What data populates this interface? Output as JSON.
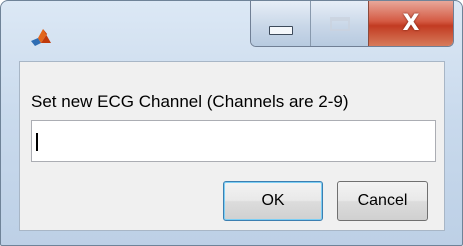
{
  "window": {
    "app_icon": "matlab-icon",
    "controls": {
      "minimize_icon": "minimize-icon",
      "maximize_icon": "maximize-icon",
      "close_icon": "close-icon",
      "close_glyph": "X"
    }
  },
  "dialog": {
    "prompt": "Set new ECG Channel (Channels are 2-9)",
    "input_value": "",
    "ok_label": "OK",
    "cancel_label": "Cancel"
  },
  "colors": {
    "close_button": "#c23b22",
    "default_button_border": "#3c7fb1",
    "frame": "#c8d9ec"
  }
}
